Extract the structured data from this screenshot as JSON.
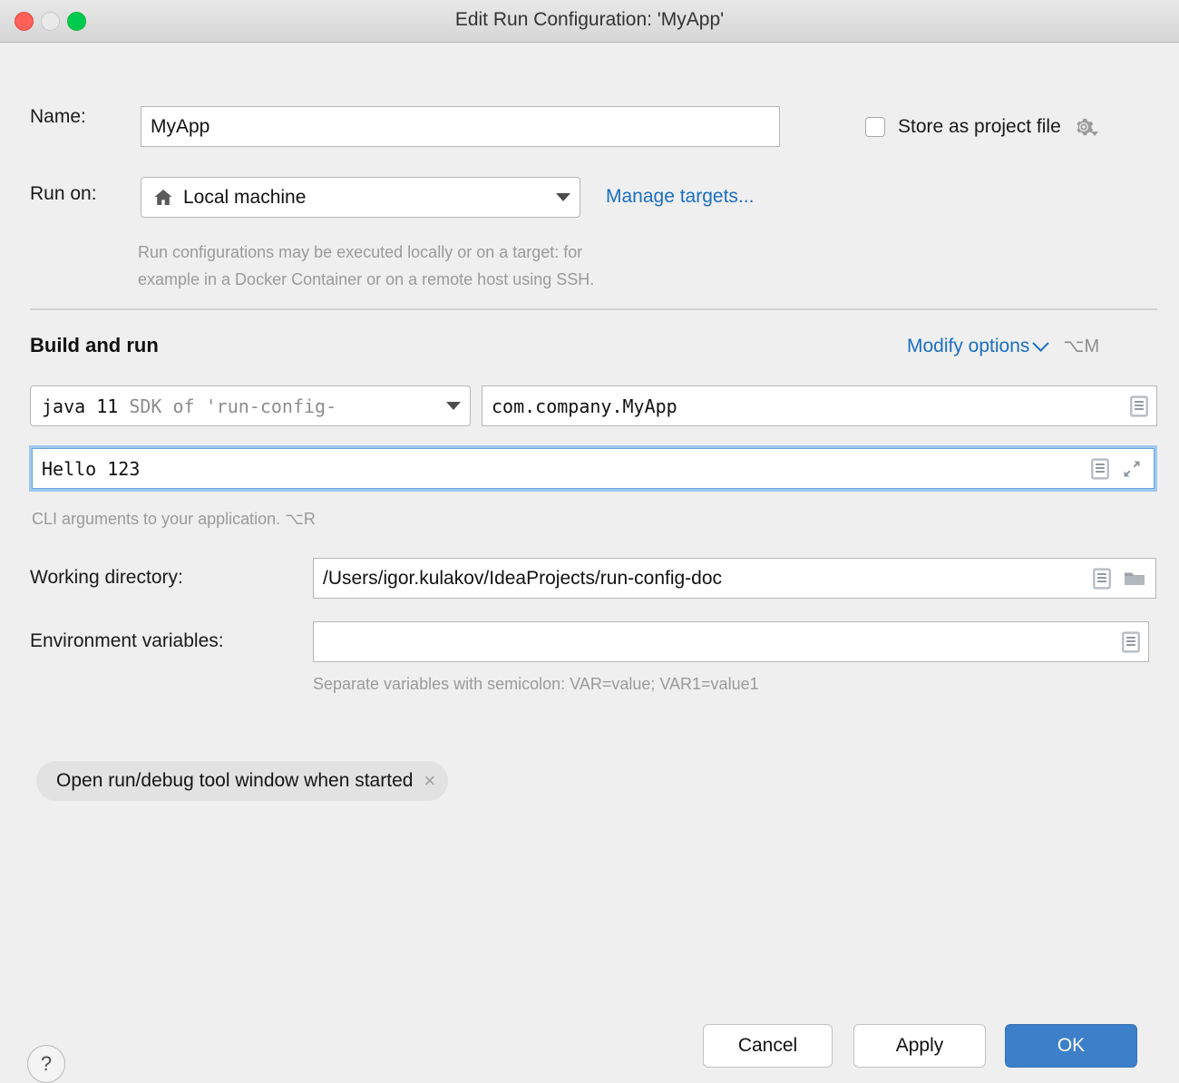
{
  "window": {
    "title": "Edit Run Configuration: 'MyApp'",
    "traffic_lights": [
      "close",
      "minimize",
      "zoom"
    ]
  },
  "name_row": {
    "label": "Name:",
    "value": "MyApp",
    "placeholder": ""
  },
  "store_as_project_file": {
    "label": "Store as project file",
    "checked": false,
    "gear_icon": "gear-icon"
  },
  "run_on": {
    "label": "Run on:",
    "value": "Local machine",
    "icon": "home-icon",
    "manage_targets_link": "Manage targets...",
    "description_line1": "Run configurations may be executed locally or on a target: for",
    "description_line2": "example in a Docker Container or on a remote host using SSH."
  },
  "build_and_run": {
    "title": "Build and run",
    "modify_options_label": "Modify options",
    "modify_options_shortcut": "⌥M",
    "jre": {
      "value_bold": "java 11",
      "value_dim": "SDK of 'run-config-"
    },
    "main_class": {
      "value": "com.company.MyApp",
      "icon": "list-browse-icon"
    },
    "program_arguments": {
      "value": "Hello 123",
      "focused": true,
      "icons": [
        "list-browse-icon",
        "expand-diagonal-icon"
      ],
      "hint": "CLI arguments to your application. ⌥R"
    },
    "working_directory": {
      "label": "Working directory:",
      "value": "/Users/igor.kulakov/IdeaProjects/run-config-doc",
      "icons": [
        "list-browse-icon",
        "folder-icon"
      ]
    },
    "environment_variables": {
      "label": "Environment variables:",
      "value": "",
      "icon": "list-browse-icon",
      "hint": "Separate variables with semicolon: VAR=value; VAR1=value1"
    },
    "option_tag": {
      "label": "Open run/debug tool window when started",
      "close": "×"
    }
  },
  "footer": {
    "help": "?",
    "cancel": "Cancel",
    "apply": "Apply",
    "ok": "OK"
  },
  "colors": {
    "background": "#efefef",
    "link": "#1a6ec2",
    "primary_button": "#3d7fc9",
    "focus_ring": "#9fc8ef",
    "hint_text": "#9a9a9a"
  }
}
